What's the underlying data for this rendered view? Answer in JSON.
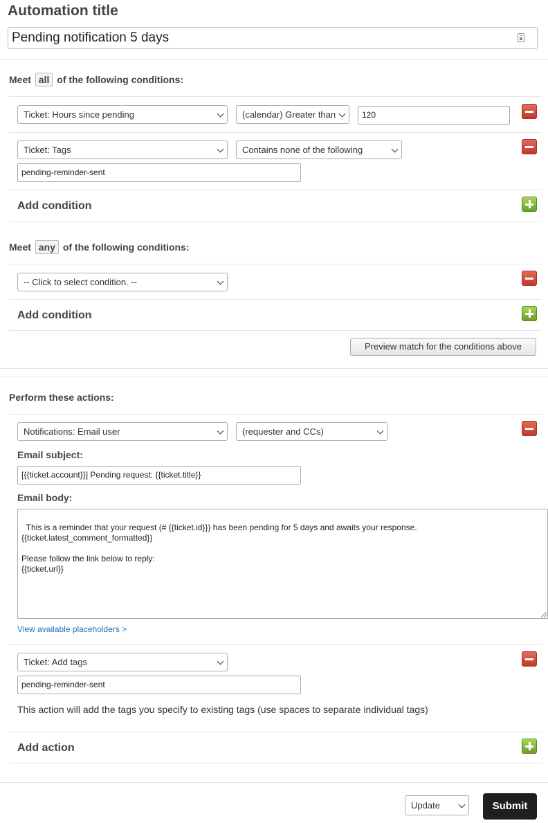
{
  "automation": {
    "title_label": "Automation title",
    "title_value": "Pending notification 5 days"
  },
  "all_section": {
    "prefix": "Meet",
    "operator": "all",
    "suffix": "of the following conditions:",
    "conditions": [
      {
        "field": "Ticket: Hours since pending",
        "operator": "(calendar) Greater than",
        "value": "120"
      },
      {
        "field": "Ticket: Tags",
        "operator": "Contains none of the following",
        "value": "pending-reminder-sent"
      }
    ],
    "add_label": "Add condition"
  },
  "any_section": {
    "prefix": "Meet",
    "operator": "any",
    "suffix": "of the following conditions:",
    "conditions": [
      {
        "field": "-- Click to select condition. --"
      }
    ],
    "add_label": "Add condition",
    "preview_label": "Preview match for the conditions above"
  },
  "actions": {
    "title": "Perform these actions:",
    "notification": {
      "field": "Notifications: Email user",
      "recipient": "(requester and CCs)",
      "subject_label": "Email subject:",
      "subject_value": "[{{ticket.account}}] Pending request: {{ticket.title}}",
      "body_label": "Email body:",
      "body_value": "This is a reminder that your request (# {{ticket.id}}) has been pending for 5 days and awaits your response.\n{{ticket.latest_comment_formatted}}\n\nPlease follow the link below to reply:\n{{ticket.url}}",
      "placeholders_link": "View available placeholders >"
    },
    "tags": {
      "field": "Ticket: Add tags",
      "value": "pending-reminder-sent",
      "help": "This action will add the tags you specify to existing tags (use spaces to separate individual tags)"
    },
    "add_label": "Add action"
  },
  "footer": {
    "update_select": "Update",
    "submit_label": "Submit"
  }
}
